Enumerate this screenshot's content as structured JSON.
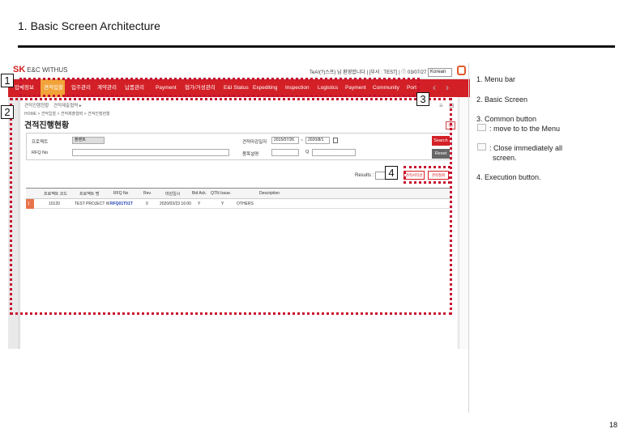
{
  "page": {
    "title": "1. Basic Screen Architecture",
    "page_number": "18"
  },
  "app": {
    "logo_main": "SK",
    "logo_sub": "E&C WITHUS",
    "user_info": "TeA!(?)스프) 님 환영합니다 | [부서 : TEST] | ⓘ 03/07/27",
    "language": "Korean"
  },
  "menu": {
    "items": [
      {
        "label": "업체정보",
        "active": false
      },
      {
        "label": "견적입찰",
        "active": true
      },
      {
        "label": "입주관리",
        "active": false
      },
      {
        "label": "계약관리",
        "active": false
      },
      {
        "label": "납품관리",
        "active": false
      },
      {
        "label": "Payment",
        "active": false
      },
      {
        "label": "협가/거성관리",
        "active": false
      },
      {
        "label": "E&I Status",
        "active": false
      },
      {
        "label": "Expediting",
        "active": false
      },
      {
        "label": "Inspection",
        "active": false
      },
      {
        "label": "Logistics",
        "active": false
      },
      {
        "label": "Payment",
        "active": false
      },
      {
        "label": "Community",
        "active": false
      },
      {
        "label": "Port",
        "active": false
      }
    ],
    "prev_arrow": "‹",
    "next_arrow": "›"
  },
  "screen": {
    "tabs": [
      "견적진행현황",
      "견적제출협력 ▸"
    ],
    "breadcrumb": "HOME > 견적입찰 > 견적제출협력 > 견적진행현황",
    "title": "견적진행현황",
    "search": {
      "project_label": "프로젝트",
      "project_value": "플랜트",
      "rfq_label": "RFQ No",
      "rfq_value": "",
      "deadline_label": "견적마감일자",
      "date_from": "2015/07/26",
      "date_sep": "~",
      "date_to": "2020/8/1",
      "description_label": "품목설명",
      "description_value": "",
      "search_button": "Search",
      "reset_button": "Reset"
    },
    "results_label": "Results : 1",
    "action_buttons": [
      "견적서작성",
      "견적철회"
    ],
    "grid": {
      "headers": [
        "프로젝트 코드",
        "프로젝트 명",
        "RFQ No",
        "Rev.",
        "마감일시",
        "Bid Ack.",
        "QTN Issue.",
        "Description"
      ],
      "rows": [
        {
          "no": "1",
          "cells": [
            "10120",
            "TEST PROJECT W",
            "RFQ01T01T",
            "0",
            "2020/03/23 16:00",
            "Y",
            "Y",
            "OTHERS"
          ]
        }
      ]
    }
  },
  "notes": {
    "n1": "1.  Menu bar",
    "n2": "2.  Basic Screen",
    "n3_line1": "3.  Common button",
    "n3_line2": ": move to to the Menu",
    "n3_line3": ": Close immediately all",
    "n3_line4": "screen.",
    "n4": "4.  Execution button."
  },
  "badges": {
    "b1": "1",
    "b2": "2",
    "b3": "3",
    "b4": "4"
  },
  "colors": {
    "menu_red": "#d32027",
    "active_orange": "#f2a33a",
    "annotation_red": "#c8102e"
  }
}
